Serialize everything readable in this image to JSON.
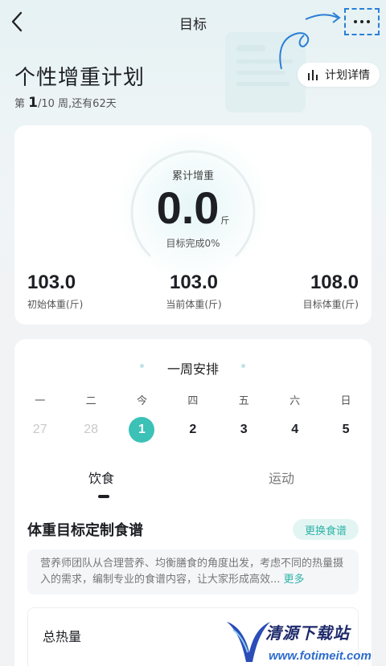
{
  "header": {
    "title": "目标",
    "back_icon": "chevron-left-icon",
    "more_icon": "more-horizontal-icon"
  },
  "plan": {
    "name": "个性增重计划",
    "week_prefix": "第 ",
    "week_current": "1",
    "week_suffix": "/10 周,还有62天",
    "detail_button": "计划详情",
    "detail_icon": "bar-chart-icon"
  },
  "summary": {
    "label": "累计增重",
    "value": "0.0",
    "unit": "斤",
    "progress_text": "目标完成0%",
    "progress_fraction": 0,
    "stats": [
      {
        "value": "103.0",
        "label": "初始体重(斤)"
      },
      {
        "value": "103.0",
        "label": "当前体重(斤)"
      },
      {
        "value": "108.0",
        "label": "目标体重(斤)"
      }
    ]
  },
  "schedule": {
    "title": "一周安排",
    "weekdays": [
      "一",
      "二",
      "今",
      "四",
      "五",
      "六",
      "日"
    ],
    "dates": [
      "27",
      "28",
      "1",
      "2",
      "3",
      "4",
      "5"
    ],
    "tabs": [
      "饮食",
      "运动"
    ],
    "recipe_title": "体重目标定制食谱",
    "change_button": "更换食谱",
    "description": "营养师团队从合理营养、均衡膳食的角度出发，考虑不同的热量摄入的需求，编制专业的食谱内容，让大家形成高效...",
    "more_link": "更多",
    "calories_label": "总热量"
  },
  "watermark": {
    "name": "清源下载站",
    "url": "www.fotimeit.com"
  },
  "colors": {
    "accent": "#3cc1b7",
    "accent_text": "#2fb3a8",
    "background": "#f2f3f5"
  }
}
